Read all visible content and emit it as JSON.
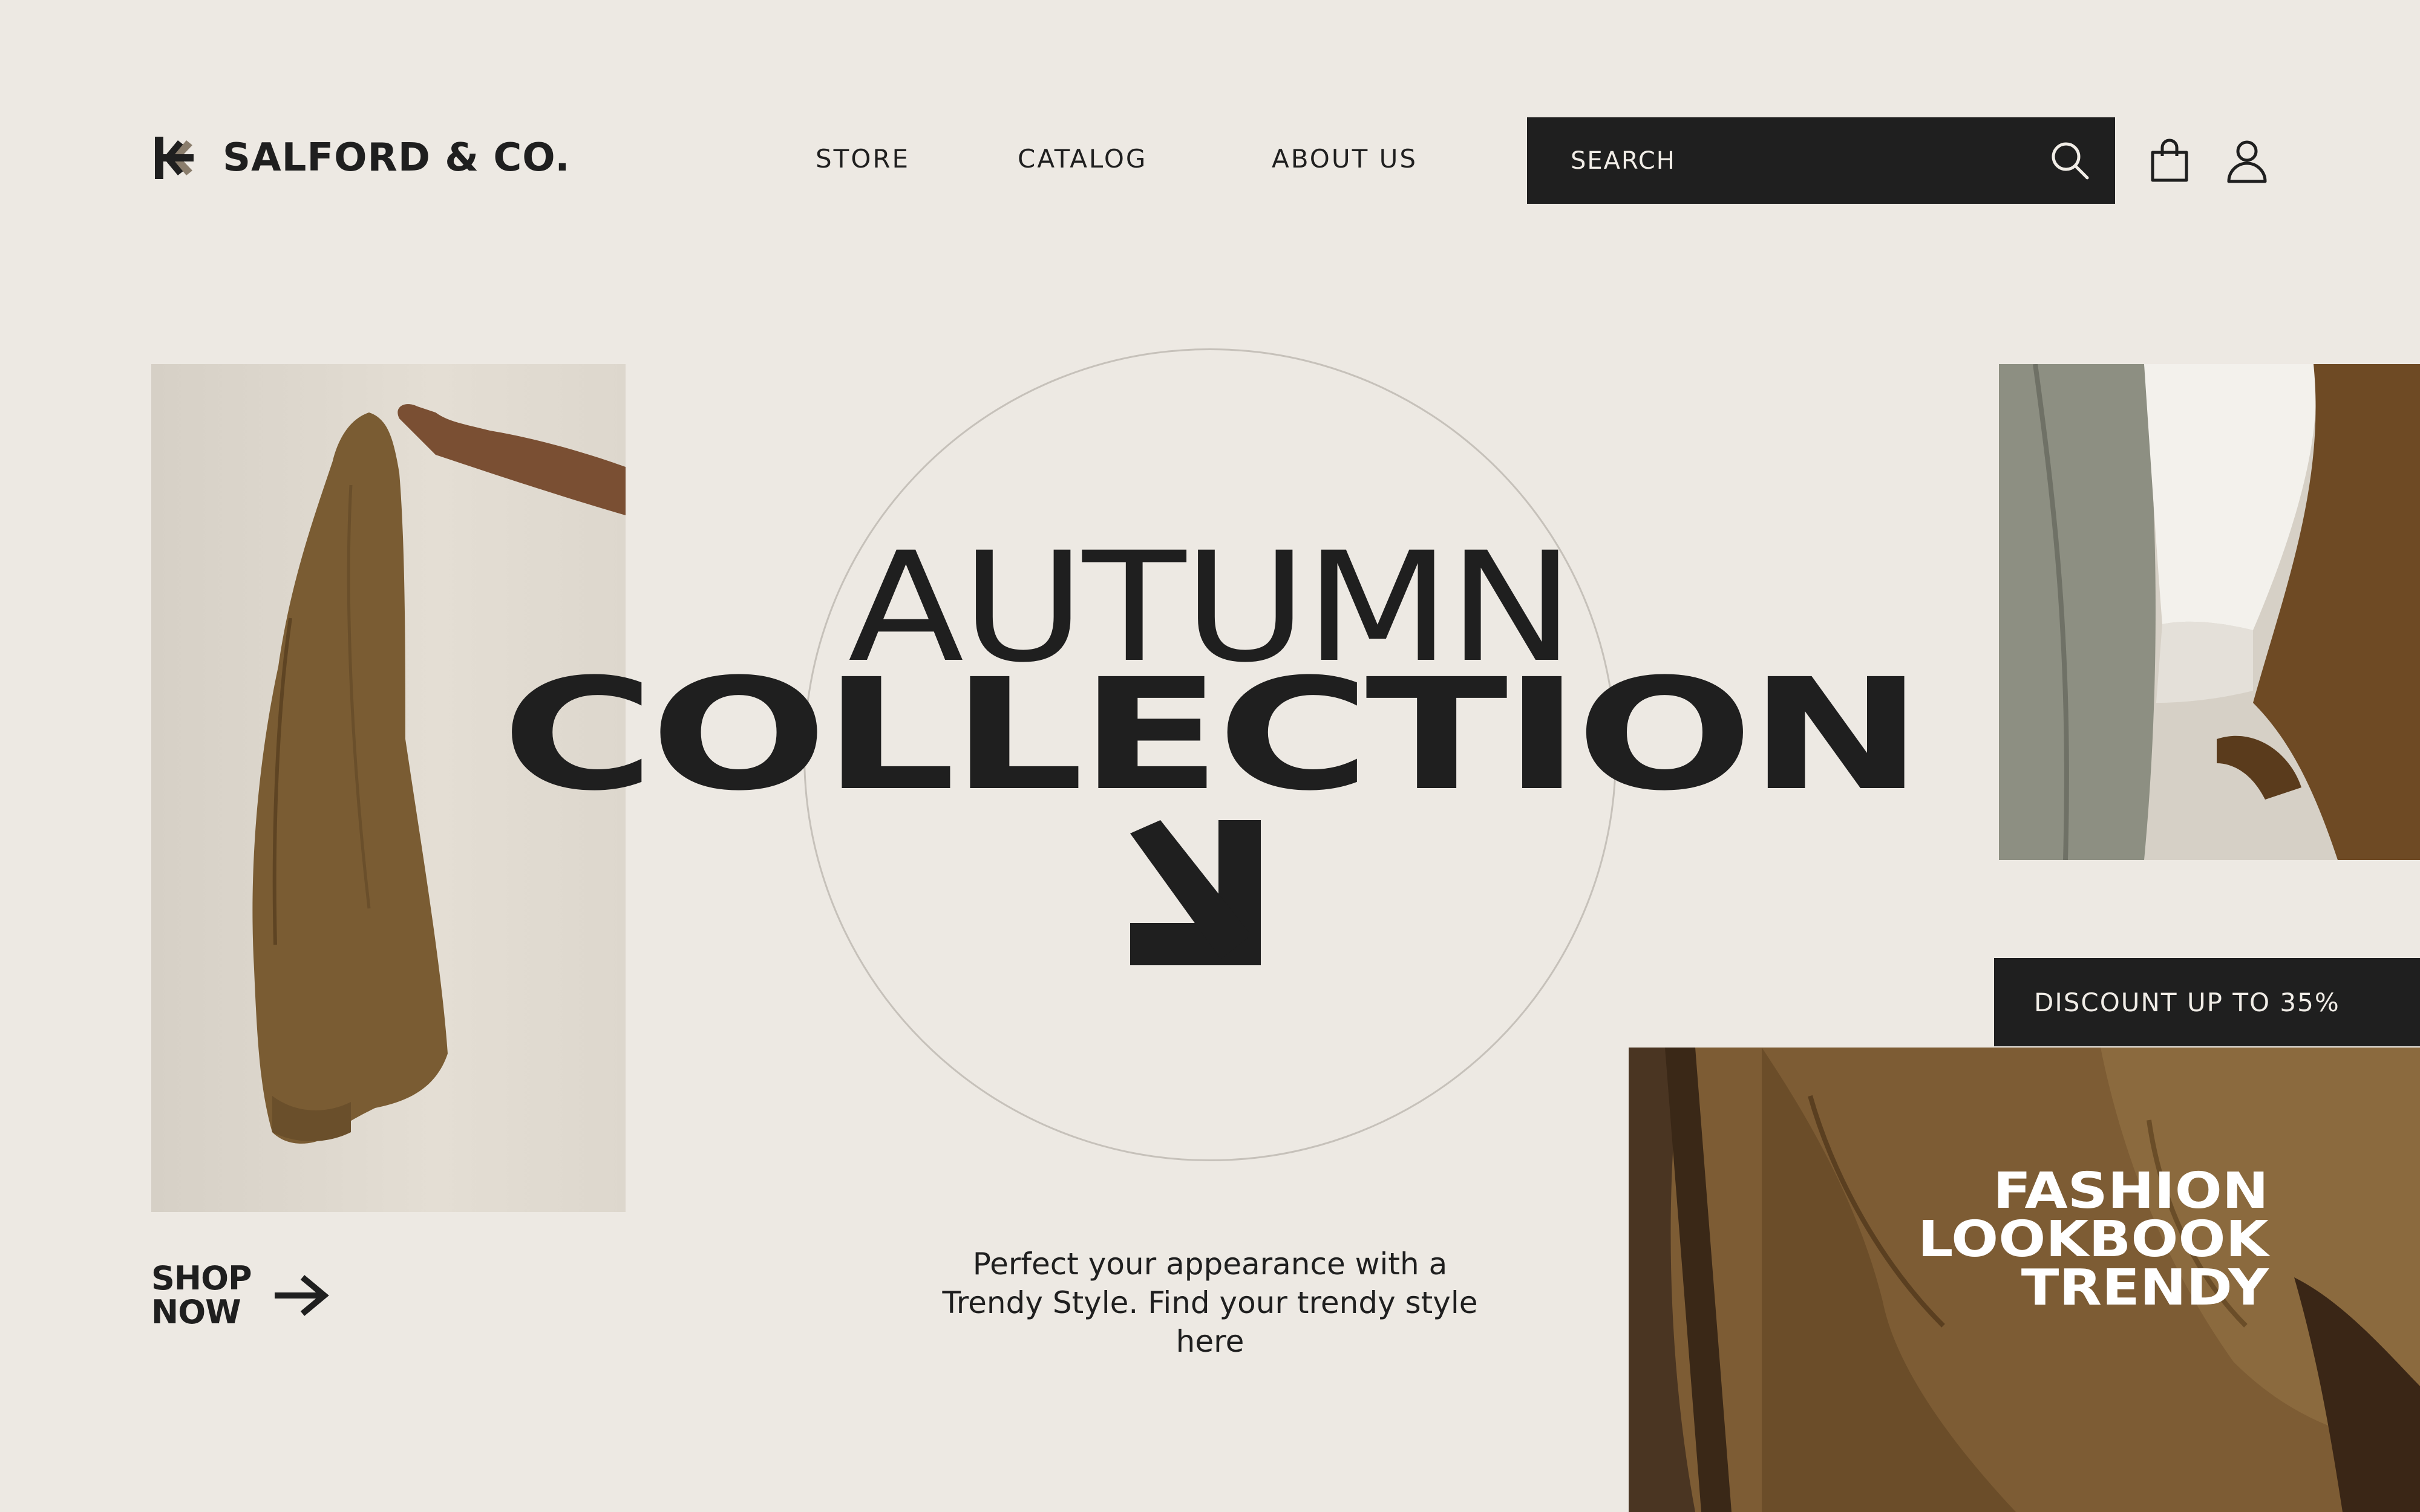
{
  "brand": {
    "name": "SALFORD & CO.",
    "logo_icon": "asterisk-logo-icon"
  },
  "nav": {
    "items": [
      {
        "label": "STORE"
      },
      {
        "label": "CATALOG"
      },
      {
        "label": "ABOUT US"
      }
    ]
  },
  "search": {
    "placeholder": "SEARCH",
    "icon": "search-icon"
  },
  "header_icons": {
    "cart": "shopping-bag-icon",
    "account": "user-icon"
  },
  "hero": {
    "line1": "AUTUMN",
    "line2": "COLLECTION",
    "arrow_icon": "arrow-down-right-icon"
  },
  "cta": {
    "shop_now": "SHOP NOW",
    "arrow_icon": "arrow-right-icon"
  },
  "tagline": "Perfect your appearance with a Trendy Style. Find your trendy style here",
  "promo": {
    "discount": "DISCOUNT UP TO 35%"
  },
  "lookbook": {
    "line1": "FASHION",
    "line2": "LOOKBOOK",
    "line3": "TRENDY"
  },
  "colors": {
    "background": "#ede9e3",
    "ink": "#1f1f1f",
    "light_text": "#f1ede7",
    "accent_brown": "#7a5c33",
    "circle": "#c6c1ba"
  }
}
